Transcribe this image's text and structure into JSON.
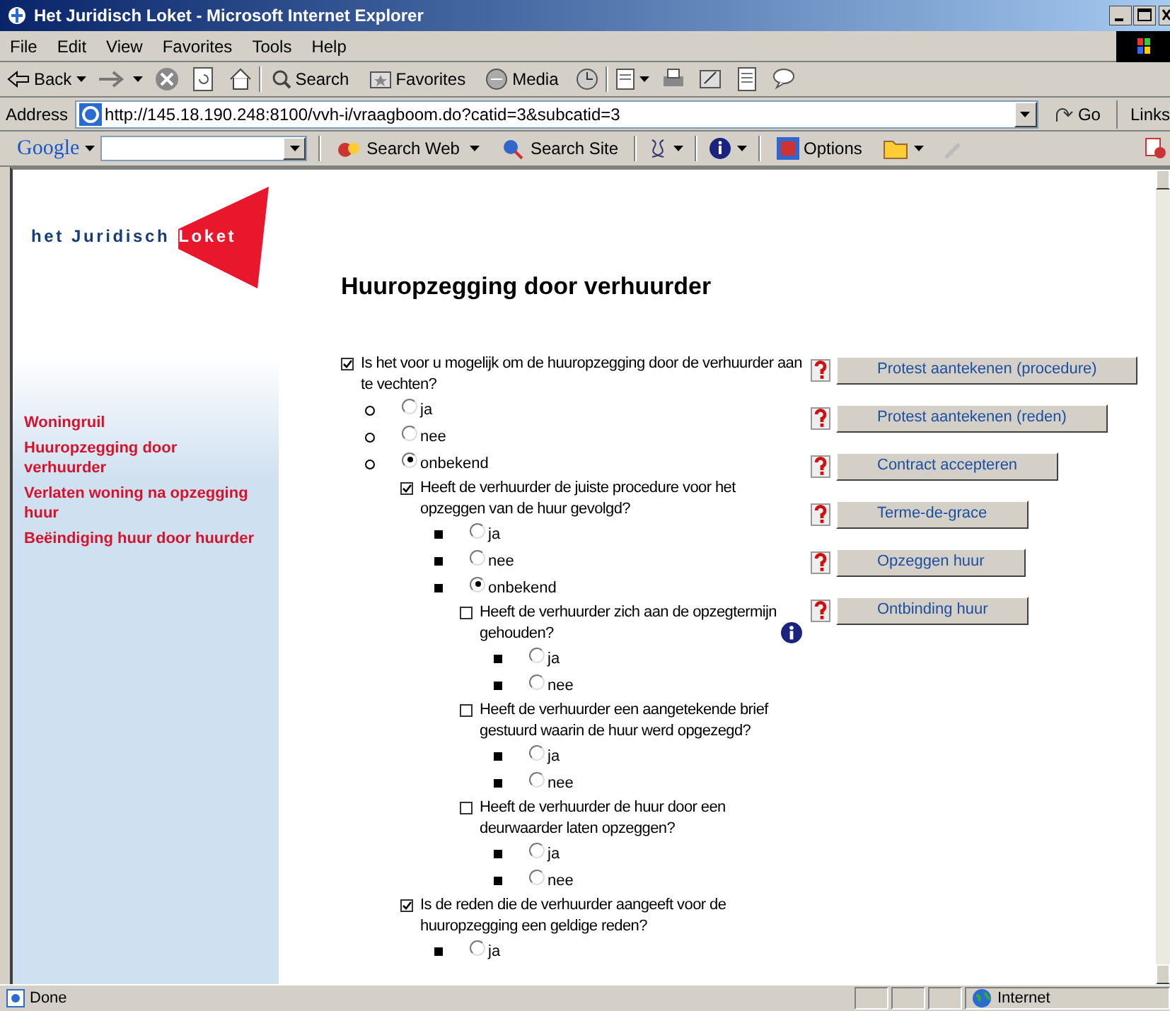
{
  "window": {
    "title": "Het Juridisch Loket - Microsoft Internet Explorer"
  },
  "menu": [
    "File",
    "Edit",
    "View",
    "Favorites",
    "Tools",
    "Help"
  ],
  "toolbar": {
    "back": "Back",
    "search": "Search",
    "favorites": "Favorites",
    "media": "Media"
  },
  "address": {
    "label": "Address",
    "url": "http://145.18.190.248:8100/vvh-i/vraagboom.do?catid=3&subcatid=3",
    "go": "Go",
    "links": "Links"
  },
  "google_bar": {
    "logo": "Google",
    "search_web": "Search Web",
    "search_site": "Search Site",
    "options": "Options"
  },
  "logo": {
    "text": "het Juridisch",
    "highlight": "Loket"
  },
  "sidebar": {
    "items": [
      "Woningruil",
      "Huuropzegging door verhuurder",
      "Verlaten woning na opzegging huur",
      "Beëindiging huur door huurder"
    ]
  },
  "page_title": "Huuropzegging door verhuurder",
  "questions": [
    {
      "text": "Is het voor u mogelijk om de huuropzegging door de verhuurder aan te vechten?",
      "checked": true,
      "info": false,
      "options": [
        {
          "label": "ja",
          "selected": false
        },
        {
          "label": "nee",
          "selected": false
        },
        {
          "label": "onbekend",
          "selected": true,
          "children": [
            {
              "text": "Heeft de verhuurder de juiste procedure voor het opzeggen van de huur gevolgd?",
              "checked": true,
              "info": false,
              "options": [
                {
                  "label": "ja",
                  "selected": false
                },
                {
                  "label": "nee",
                  "selected": false
                },
                {
                  "label": "onbekend",
                  "selected": true,
                  "children": [
                    {
                      "text": "Heeft de verhuurder zich aan de opzegtermijn gehouden?",
                      "checked": false,
                      "info": true,
                      "options": [
                        {
                          "label": "ja",
                          "selected": false
                        },
                        {
                          "label": "nee",
                          "selected": false
                        }
                      ]
                    },
                    {
                      "text": "Heeft de verhuurder een aangetekende brief gestuurd waarin de huur werd opgezegd?",
                      "checked": false,
                      "info": false,
                      "options": [
                        {
                          "label": "ja",
                          "selected": false
                        },
                        {
                          "label": "nee",
                          "selected": false
                        }
                      ]
                    },
                    {
                      "text": "Heeft de verhuurder de huur door een deurwaarder laten opzeggen?",
                      "checked": false,
                      "info": false,
                      "options": [
                        {
                          "label": "ja",
                          "selected": false
                        },
                        {
                          "label": "nee",
                          "selected": false
                        }
                      ]
                    }
                  ]
                }
              ]
            },
            {
              "text": "Is de reden die de verhuurder aangeeft voor de huuropzegging een geldige reden?",
              "checked": true,
              "info": false,
              "options": [
                {
                  "label": "ja",
                  "selected": false
                }
              ]
            }
          ]
        }
      ]
    }
  ],
  "actions": [
    "Protest aantekenen (procedure)",
    "Protest aantekenen (reden)",
    "Contract accepteren",
    "Terme-de-grace",
    "Opzeggen huur",
    "Ontbinding huur"
  ],
  "status_bar": {
    "text": "Done",
    "zone": "Internet"
  }
}
